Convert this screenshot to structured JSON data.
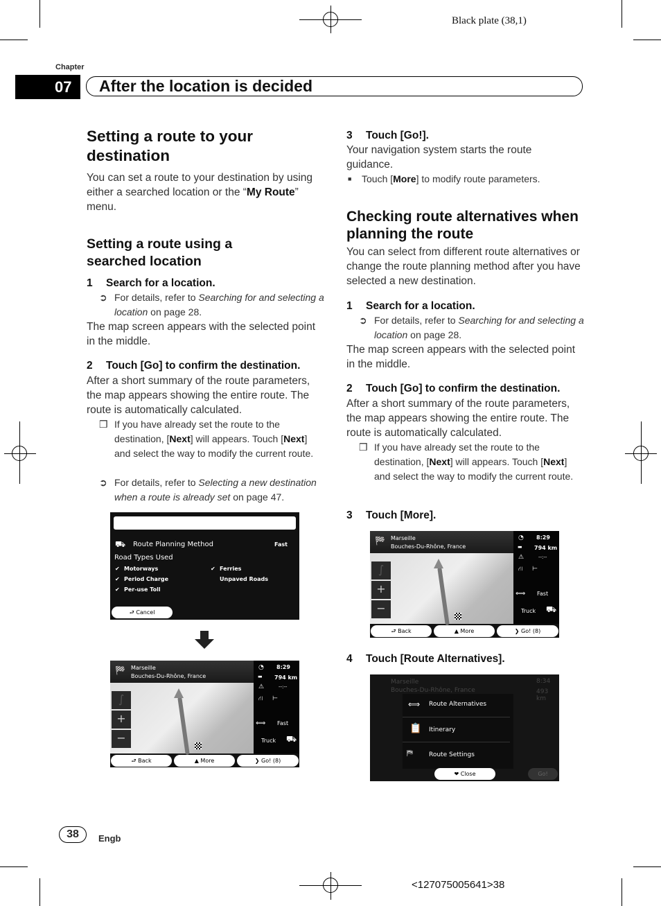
{
  "plate": {
    "top": "Black plate (38,1)",
    "bottom": "<127075005641>38"
  },
  "chapter": {
    "label": "Chapter",
    "number": "07",
    "title": "After the location is decided"
  },
  "left": {
    "h2": "Setting a route to your destination",
    "intro_a": "You can set a route to your destination by using either a searched location or the “",
    "intro_b": "My Route",
    "intro_c": "” menu.",
    "h3": "Setting a route using a searched location",
    "s1_n": "1",
    "s1": "Search for a location.",
    "s1_note_a": "For details, refer to ",
    "s1_note_i": "Searching for and selecting a location",
    "s1_note_c": " on page 28.",
    "s1_p": "The map screen appears with the selected point in the middle.",
    "s2_n": "2",
    "s2": "Touch [Go] to confirm the destination.",
    "s2_p": "After a short summary of the route parameters, the map appears showing the entire route. The route is automatically calculated.",
    "s2_b_a": "If you have already set the route to the destination, [",
    "s2_b_next": "Next",
    "s2_b_b": "] will appears. Touch [",
    "s2_b_next2": "Next",
    "s2_b_c": "] and select the way to modify the current route.",
    "s2_n2_a": "For details, refer to ",
    "s2_n2_i": "Selecting a new destination when a route is already set",
    "s2_n2_c": " on page 47."
  },
  "right": {
    "s3_n": "3",
    "s3": "Touch [Go!].",
    "s3_p": "Your navigation system starts the route guidance.",
    "s3_b_a": "Touch [",
    "s3_b_more": "More",
    "s3_b_c": "] to modify route parameters.",
    "h2": "Checking route alternatives when planning the route",
    "intro": "You can select from different route alternatives or change the route planning method after you have selected a new destination.",
    "s1_n": "1",
    "s1": "Search for a location.",
    "s1_note_a": "For details, refer to ",
    "s1_note_i": "Searching for and selecting a location",
    "s1_note_c": " on page 28.",
    "s1_p": "The map screen appears with the selected point in the middle.",
    "s2_n": "2",
    "s2": "Touch [Go] to confirm the destination.",
    "s2_p": "After a short summary of the route parameters, the map appears showing the entire route. The route is automatically calculated.",
    "s2_b_a": "If you have already set the route to the destination, [",
    "s2_b_next": "Next",
    "s2_b_b": "] will appears. Touch [",
    "s2_b_next2": "Next",
    "s2_b_c": "] and select the way to modify the current route.",
    "s3b_n": "3",
    "s3b": "Touch [More].",
    "s4_n": "4",
    "s4": "Touch [Route Alternatives]."
  },
  "screen_settings": {
    "method": "Route Planning Method",
    "method_val": "Fast",
    "road_types": "Road Types Used",
    "roads": [
      {
        "label": "Motorways",
        "checked": true
      },
      {
        "label": "Period Charge",
        "checked": true
      },
      {
        "label": "Per-use Toll",
        "checked": true
      },
      {
        "label": "Ferries",
        "checked": true
      },
      {
        "label": "Unpaved Roads",
        "checked": false
      }
    ],
    "cancel": "Cancel"
  },
  "map_screen": {
    "city": "Marseille",
    "region": "Bouches-Du-Rhône, France",
    "time": "8:29",
    "distance": "794 km",
    "eta": "--:--",
    "method": "Fast",
    "vehicle": "Truck",
    "back": "Back",
    "more": "More",
    "go": "Go! (8)"
  },
  "menu_screen": {
    "city": "Marseille",
    "region": "Bouches-Du-Rhône, France",
    "time": "8:34",
    "distance": "493 km",
    "items": [
      "Route Alternatives",
      "Itinerary",
      "Route Settings"
    ],
    "close": "Close",
    "go": "Go!"
  },
  "footer": {
    "page": "38",
    "lang": "Engb"
  }
}
